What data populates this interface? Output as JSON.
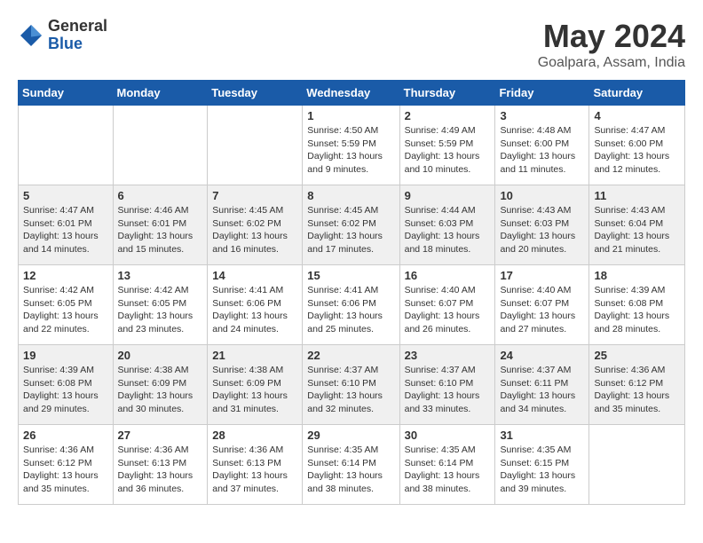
{
  "header": {
    "logo_general": "General",
    "logo_blue": "Blue",
    "title": "May 2024",
    "subtitle": "Goalpara, Assam, India"
  },
  "days_of_week": [
    "Sunday",
    "Monday",
    "Tuesday",
    "Wednesday",
    "Thursday",
    "Friday",
    "Saturday"
  ],
  "weeks": [
    [
      {
        "day": "",
        "info": ""
      },
      {
        "day": "",
        "info": ""
      },
      {
        "day": "",
        "info": ""
      },
      {
        "day": "1",
        "info": "Sunrise: 4:50 AM\nSunset: 5:59 PM\nDaylight: 13 hours\nand 9 minutes."
      },
      {
        "day": "2",
        "info": "Sunrise: 4:49 AM\nSunset: 5:59 PM\nDaylight: 13 hours\nand 10 minutes."
      },
      {
        "day": "3",
        "info": "Sunrise: 4:48 AM\nSunset: 6:00 PM\nDaylight: 13 hours\nand 11 minutes."
      },
      {
        "day": "4",
        "info": "Sunrise: 4:47 AM\nSunset: 6:00 PM\nDaylight: 13 hours\nand 12 minutes."
      }
    ],
    [
      {
        "day": "5",
        "info": "Sunrise: 4:47 AM\nSunset: 6:01 PM\nDaylight: 13 hours\nand 14 minutes."
      },
      {
        "day": "6",
        "info": "Sunrise: 4:46 AM\nSunset: 6:01 PM\nDaylight: 13 hours\nand 15 minutes."
      },
      {
        "day": "7",
        "info": "Sunrise: 4:45 AM\nSunset: 6:02 PM\nDaylight: 13 hours\nand 16 minutes."
      },
      {
        "day": "8",
        "info": "Sunrise: 4:45 AM\nSunset: 6:02 PM\nDaylight: 13 hours\nand 17 minutes."
      },
      {
        "day": "9",
        "info": "Sunrise: 4:44 AM\nSunset: 6:03 PM\nDaylight: 13 hours\nand 18 minutes."
      },
      {
        "day": "10",
        "info": "Sunrise: 4:43 AM\nSunset: 6:03 PM\nDaylight: 13 hours\nand 20 minutes."
      },
      {
        "day": "11",
        "info": "Sunrise: 4:43 AM\nSunset: 6:04 PM\nDaylight: 13 hours\nand 21 minutes."
      }
    ],
    [
      {
        "day": "12",
        "info": "Sunrise: 4:42 AM\nSunset: 6:05 PM\nDaylight: 13 hours\nand 22 minutes."
      },
      {
        "day": "13",
        "info": "Sunrise: 4:42 AM\nSunset: 6:05 PM\nDaylight: 13 hours\nand 23 minutes."
      },
      {
        "day": "14",
        "info": "Sunrise: 4:41 AM\nSunset: 6:06 PM\nDaylight: 13 hours\nand 24 minutes."
      },
      {
        "day": "15",
        "info": "Sunrise: 4:41 AM\nSunset: 6:06 PM\nDaylight: 13 hours\nand 25 minutes."
      },
      {
        "day": "16",
        "info": "Sunrise: 4:40 AM\nSunset: 6:07 PM\nDaylight: 13 hours\nand 26 minutes."
      },
      {
        "day": "17",
        "info": "Sunrise: 4:40 AM\nSunset: 6:07 PM\nDaylight: 13 hours\nand 27 minutes."
      },
      {
        "day": "18",
        "info": "Sunrise: 4:39 AM\nSunset: 6:08 PM\nDaylight: 13 hours\nand 28 minutes."
      }
    ],
    [
      {
        "day": "19",
        "info": "Sunrise: 4:39 AM\nSunset: 6:08 PM\nDaylight: 13 hours\nand 29 minutes."
      },
      {
        "day": "20",
        "info": "Sunrise: 4:38 AM\nSunset: 6:09 PM\nDaylight: 13 hours\nand 30 minutes."
      },
      {
        "day": "21",
        "info": "Sunrise: 4:38 AM\nSunset: 6:09 PM\nDaylight: 13 hours\nand 31 minutes."
      },
      {
        "day": "22",
        "info": "Sunrise: 4:37 AM\nSunset: 6:10 PM\nDaylight: 13 hours\nand 32 minutes."
      },
      {
        "day": "23",
        "info": "Sunrise: 4:37 AM\nSunset: 6:10 PM\nDaylight: 13 hours\nand 33 minutes."
      },
      {
        "day": "24",
        "info": "Sunrise: 4:37 AM\nSunset: 6:11 PM\nDaylight: 13 hours\nand 34 minutes."
      },
      {
        "day": "25",
        "info": "Sunrise: 4:36 AM\nSunset: 6:12 PM\nDaylight: 13 hours\nand 35 minutes."
      }
    ],
    [
      {
        "day": "26",
        "info": "Sunrise: 4:36 AM\nSunset: 6:12 PM\nDaylight: 13 hours\nand 35 minutes."
      },
      {
        "day": "27",
        "info": "Sunrise: 4:36 AM\nSunset: 6:13 PM\nDaylight: 13 hours\nand 36 minutes."
      },
      {
        "day": "28",
        "info": "Sunrise: 4:36 AM\nSunset: 6:13 PM\nDaylight: 13 hours\nand 37 minutes."
      },
      {
        "day": "29",
        "info": "Sunrise: 4:35 AM\nSunset: 6:14 PM\nDaylight: 13 hours\nand 38 minutes."
      },
      {
        "day": "30",
        "info": "Sunrise: 4:35 AM\nSunset: 6:14 PM\nDaylight: 13 hours\nand 38 minutes."
      },
      {
        "day": "31",
        "info": "Sunrise: 4:35 AM\nSunset: 6:15 PM\nDaylight: 13 hours\nand 39 minutes."
      },
      {
        "day": "",
        "info": ""
      }
    ]
  ]
}
